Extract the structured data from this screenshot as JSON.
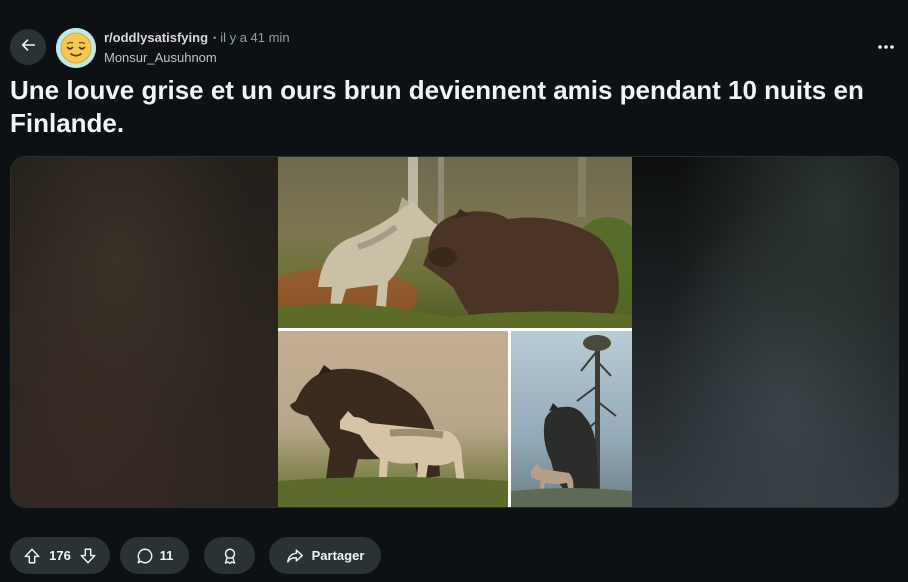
{
  "header": {
    "subreddit": "r/oddlysatisfying",
    "separator": "•",
    "time": "il y a 41 min",
    "author": "Monsur_Ausuhnom",
    "icons": {
      "back": "back-arrow-icon",
      "avatar": "relieved-face-icon",
      "more": "more-dots-icon"
    }
  },
  "post": {
    "title": "Une louve grise et un ours brun deviennent amis pendant 10 nuits en Finlande."
  },
  "media": {
    "photos": [
      "wolf-and-bear-nose-to-nose-photo",
      "bear-and-wolf-on-grass-photo",
      "bear-and-wolf-under-pine-photo"
    ]
  },
  "actions": {
    "votes": "176",
    "comments": "11",
    "share_label": "Partager",
    "icons": {
      "upvote": "upvote-arrow-icon",
      "downvote": "downvote-arrow-icon",
      "comment": "comment-bubble-icon",
      "award": "award-ribbon-icon",
      "share": "share-arrow-icon"
    }
  },
  "colors": {
    "background": "#0e1113",
    "pill": "#2a3236",
    "text": "#f2f4f5",
    "muted": "#8ba2ad",
    "avatar": "#b9ebef"
  }
}
